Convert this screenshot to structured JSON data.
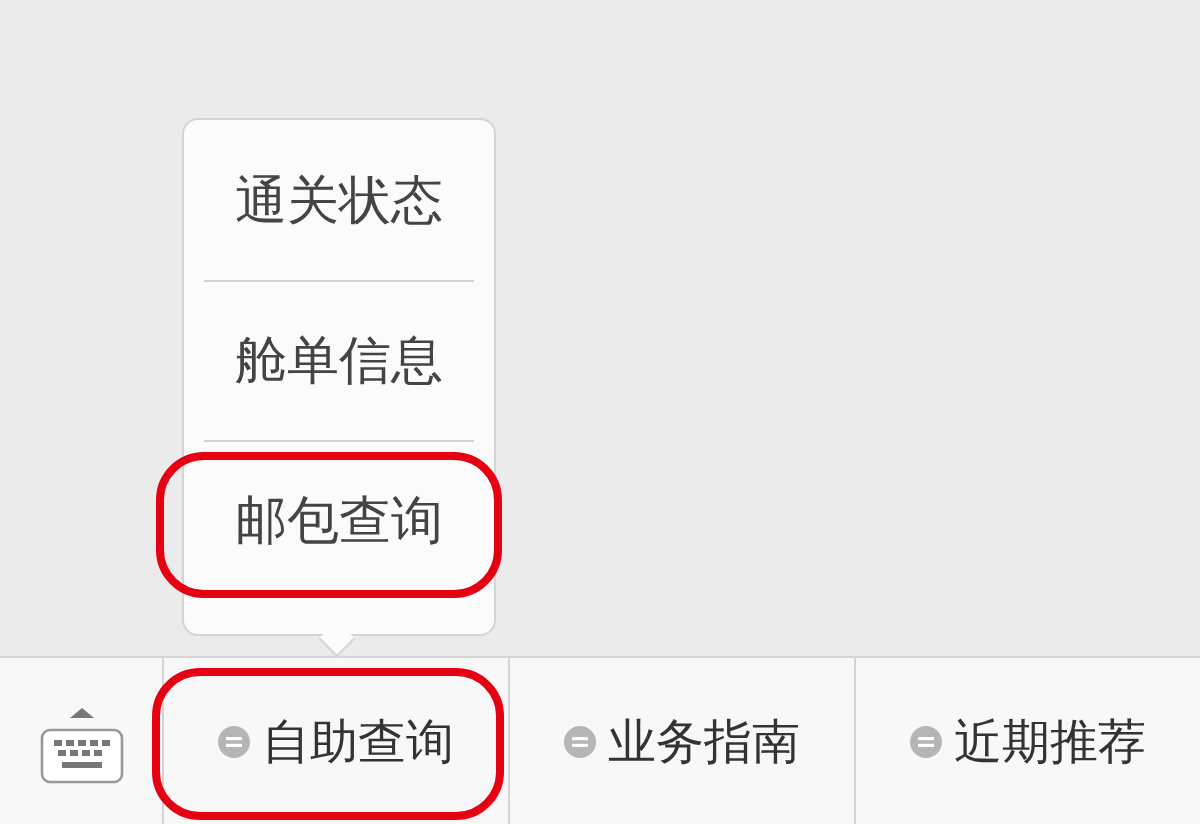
{
  "bottom_menu": {
    "tabs": [
      {
        "label": "自助查询",
        "highlighted": true,
        "submenu": [
          {
            "label": "通关状态",
            "highlighted": false
          },
          {
            "label": "舱单信息",
            "highlighted": false
          },
          {
            "label": "邮包查询",
            "highlighted": true
          }
        ]
      },
      {
        "label": "业务指南",
        "highlighted": false
      },
      {
        "label": "近期推荐",
        "highlighted": false
      }
    ]
  }
}
